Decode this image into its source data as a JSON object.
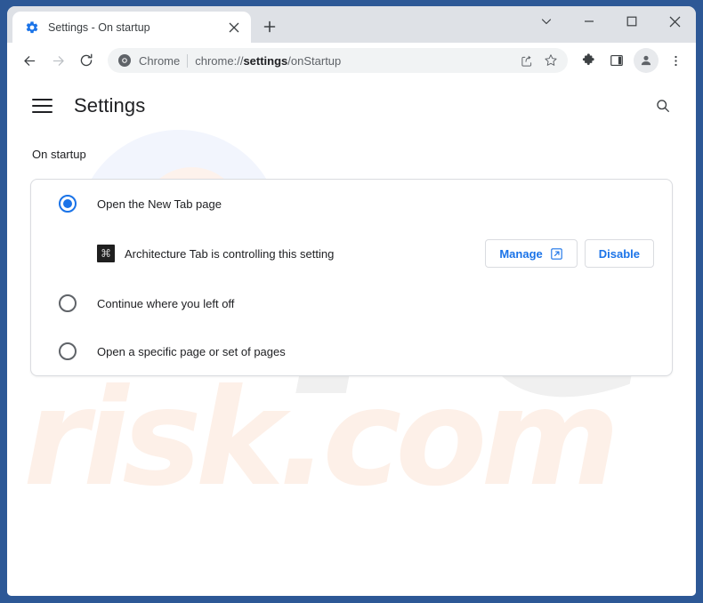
{
  "window": {
    "controls": [
      {
        "name": "chevron-down-icon",
        "label": "⌄"
      },
      {
        "name": "minimize-icon",
        "label": "–"
      },
      {
        "name": "maximize-icon",
        "label": "□"
      },
      {
        "name": "close-icon",
        "label": "✕"
      }
    ]
  },
  "tab": {
    "title": "Settings - On startup",
    "favicon": "gear-icon",
    "close_label": "✕",
    "newtab_label": "+"
  },
  "toolbar": {
    "back_icon": "back-arrow-icon",
    "forward_icon": "forward-arrow-icon",
    "reload_icon": "reload-icon",
    "omnibox": {
      "chrome_label": "Chrome",
      "url_prefix": "chrome://",
      "url_bold": "settings",
      "url_suffix": "/onStartup",
      "share_icon": "share-icon",
      "bookmark_icon": "bookmark-star-icon"
    },
    "extensions_icon": "puzzle-piece-icon",
    "sidepanel_icon": "side-panel-icon",
    "profile_icon": "profile-avatar-icon",
    "menu_icon": "three-dot-menu-icon"
  },
  "settings": {
    "menu_label": "hamburger-menu-icon",
    "title": "Settings",
    "search_label": "search-icon",
    "section_label": "On startup",
    "options": [
      {
        "label": "Open the New Tab page",
        "checked": true
      },
      {
        "label": "Continue where you left off",
        "checked": false
      },
      {
        "label": "Open a specific page or set of pages",
        "checked": false
      }
    ],
    "extension_notice": {
      "icon": "extension-icon",
      "icon_glyph": "⌘",
      "text": "Architecture Tab is controlling this setting",
      "manage_label": "Manage",
      "manage_icon": "external-link-icon",
      "disable_label": "Disable"
    }
  },
  "watermark": {
    "primary": "PC",
    "secondary": "risk.com"
  },
  "colors": {
    "accent": "#1a73e8",
    "frame": "#2d5896",
    "tabstrip": "#dee1e6",
    "card_border": "#dadce0",
    "text_primary": "#202124",
    "text_secondary": "#5f6368"
  }
}
